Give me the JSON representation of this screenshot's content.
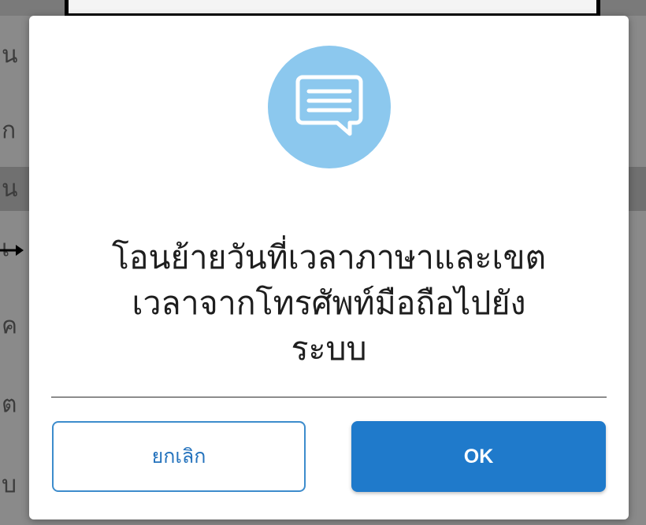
{
  "background": {
    "rows": [
      {
        "glyph": "น"
      },
      {
        "glyph": "ก"
      },
      {
        "glyph": "น"
      },
      {
        "glyph": "เ"
      },
      {
        "glyph": "ค"
      },
      {
        "glyph": "ต"
      },
      {
        "glyph": "บ"
      }
    ]
  },
  "dialog": {
    "icon": "chat-message-icon",
    "message": "โอนย้ายวันที่เวลาภาษาและเขตเวลาจากโทรศัพท์มือถือไปยังระบบ",
    "message_lines": [
      "โอนย้ายวันที่เวลาภาษาและเขต",
      "เวลาจากโทรศัพท์มือถือไปยัง",
      "ระบบ"
    ],
    "cancel_label": "ยกเลิก",
    "ok_label": "OK"
  },
  "colors": {
    "accent": "#1f7acb",
    "icon_circle": "#8cc8ee",
    "overlay": "#7a7a7a"
  }
}
